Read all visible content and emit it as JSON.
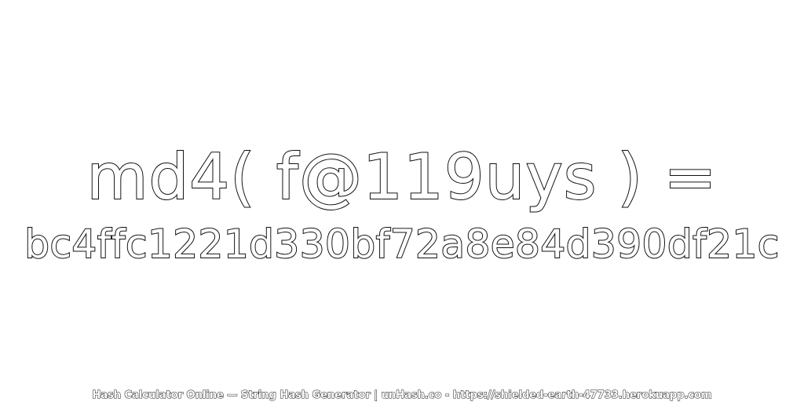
{
  "expression": "md4( f@119uys ) =",
  "hash": "bc4ffc1221d330bf72a8e84d390df21c",
  "footer": "Hash Calculator Online — String Hash Generator | unHash.co - https://shielded-earth-47733.herokuapp.com",
  "colors": {
    "background": "#ffffff",
    "text_fill": "#ffffff",
    "text_outline": "#111111"
  }
}
